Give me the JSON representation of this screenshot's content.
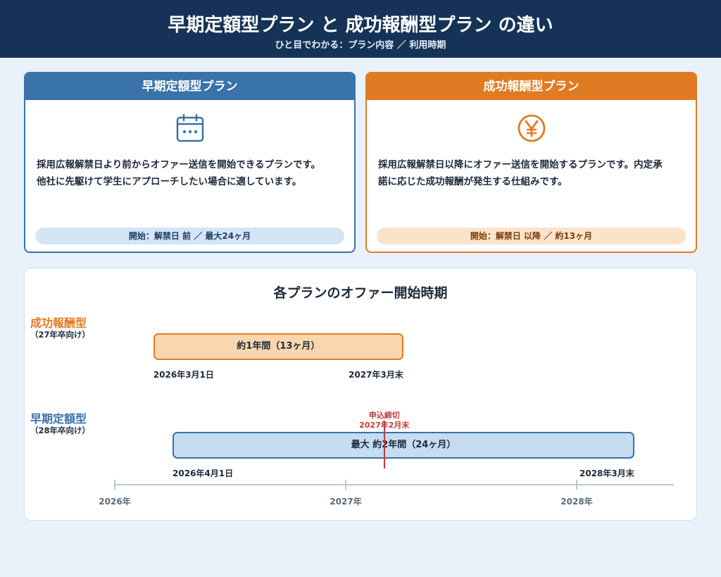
{
  "header": {
    "title": "早期定額型プラン と 成功報酬型プラン の違い",
    "subtitle": "ひと目でわかる：プラン内容 ／ 利用時期"
  },
  "plans": {
    "early": {
      "name": "早期定額型プラン",
      "icon": "calendar-icon",
      "description_line1": "採用広報解禁日より前からオファー送信を開始できるプランです。",
      "description_line2": "他社に先駆けて学生にアプローチしたい場合に適しています。",
      "summary": "開始：解禁日 前 ／ 最大24ヶ月",
      "color": "#3a72aa"
    },
    "success": {
      "name": "成功報酬型プラン",
      "icon": "yen-icon",
      "description_line1": "採用広報解禁日以降にオファー送信を開始するプランです。内定承",
      "description_line2": "諾に応じた成功報酬が発生する仕組みです。",
      "summary": "開始：解禁日 以降 ／ 約13ヶ月",
      "color": "#e07b23"
    }
  },
  "timeline": {
    "title": "各プランのオファー開始時期",
    "success_row": {
      "label": "成功報酬型",
      "sub": "（27年卒向け）",
      "bar_text": "約1年間（13ヶ月）",
      "start_label": "2026年3月1日",
      "end_label": "2027年3月末",
      "start": 2026.167,
      "end": 2027.25
    },
    "early_row": {
      "label": "早期定額型",
      "sub": "（28年卒向け）",
      "bar_text": "最大 約2年間（24ヶ月）",
      "start_label": "2026年4月1日",
      "end_label": "2028年3月末",
      "start": 2026.25,
      "end": 2028.25
    },
    "deadline": {
      "line1": "申込締切",
      "line2": "2027年2月末",
      "at": 2027.167
    },
    "axis": [
      {
        "label": "2026年",
        "value": 2026
      },
      {
        "label": "2027年",
        "value": 2027
      },
      {
        "label": "2028年",
        "value": 2028
      }
    ]
  }
}
